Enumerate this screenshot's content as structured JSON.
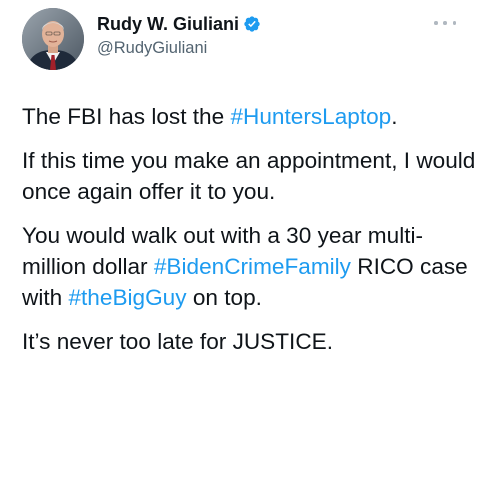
{
  "author": {
    "display_name": "Rudy W. Giuliani",
    "handle": "@RudyGiuliani",
    "verified": true
  },
  "icons": {
    "verified": "verified-badge-icon",
    "more": "more-dots-icon"
  },
  "colors": {
    "text": "#0f1419",
    "secondary": "#536471",
    "link": "#1d9bf0"
  },
  "tweet": {
    "p1": {
      "t1": "The FBI has lost the ",
      "hashtag1": "#HuntersLaptop",
      "t2": "."
    },
    "p2": {
      "t1": "If this time you make an appointment, I would once again offer it to you."
    },
    "p3": {
      "t1": "You would walk out with a 30 year multi-million dollar ",
      "hashtag1": "#BidenCrimeFamily",
      "t2": " RICO case with ",
      "hashtag2": "#theBigGuy",
      "t3": " on top."
    },
    "p4": {
      "t1": "It’s never too late for JUSTICE."
    }
  }
}
